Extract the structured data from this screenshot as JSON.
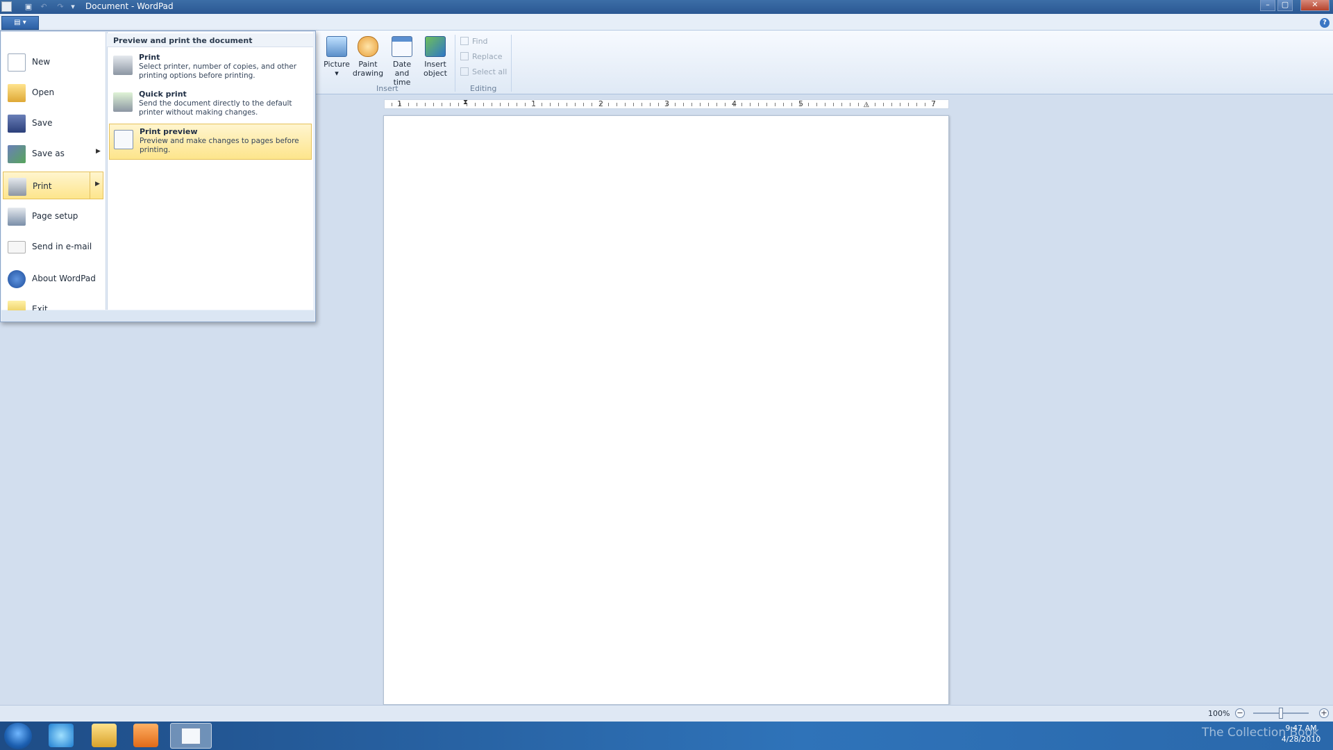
{
  "window": {
    "title": "Document - WordPad",
    "controls": {
      "minimize": "–",
      "maximize": "▢",
      "close": "✕"
    },
    "help": "?"
  },
  "app_button": {
    "label": "▤ ▾"
  },
  "ribbon": {
    "insert_group": {
      "label": "Insert",
      "buttons": [
        {
          "label": "Picture",
          "sublabel": "▾",
          "icon": "picture-icon"
        },
        {
          "label": "Paint",
          "sublabel": "drawing",
          "icon": "paint-drawing-icon"
        },
        {
          "label": "Date and",
          "sublabel": "time",
          "icon": "calendar-icon"
        },
        {
          "label": "Insert",
          "sublabel": "object",
          "icon": "insert-object-icon"
        }
      ]
    },
    "editing_group": {
      "label": "Editing",
      "items": [
        "Find",
        "Replace",
        "Select all"
      ]
    }
  },
  "app_menu": {
    "items": [
      {
        "label": "New",
        "icon": "new-document-icon"
      },
      {
        "label": "Open",
        "icon": "open-folder-icon"
      },
      {
        "label": "Save",
        "icon": "save-icon"
      },
      {
        "label": "Save as",
        "icon": "save-as-icon",
        "has_submenu": true
      },
      {
        "label": "Print",
        "icon": "printer-icon",
        "has_submenu": true,
        "highlighted": true
      },
      {
        "label": "Page setup",
        "icon": "page-setup-icon"
      },
      {
        "label": "Send in e-mail",
        "icon": "email-icon"
      },
      {
        "label": "About WordPad",
        "icon": "info-icon"
      },
      {
        "label": "Exit",
        "icon": "exit-icon"
      }
    ],
    "submenu": {
      "header": "Preview and print the document",
      "items": [
        {
          "title": "Print",
          "desc": "Select printer, number of copies, and other printing options before printing.",
          "icon": "printer-icon"
        },
        {
          "title": "Quick print",
          "desc": "Send the document directly to the default printer without making changes.",
          "icon": "quick-print-icon"
        },
        {
          "title": "Print preview",
          "desc": "Preview and make changes to pages before printing.",
          "icon": "print-preview-icon",
          "highlighted": true
        }
      ]
    }
  },
  "ruler": {
    "numbers": [
      "1",
      "1",
      "2",
      "3",
      "4",
      "5",
      "7"
    ]
  },
  "status": {
    "zoom": "100%",
    "zoom_out": "−",
    "zoom_in": "+",
    "zoom_level": 0.5
  },
  "taskbar": {
    "clock_time": "9:47 AM",
    "clock_date": "4/28/2010",
    "watermark": "The Collection Book"
  }
}
